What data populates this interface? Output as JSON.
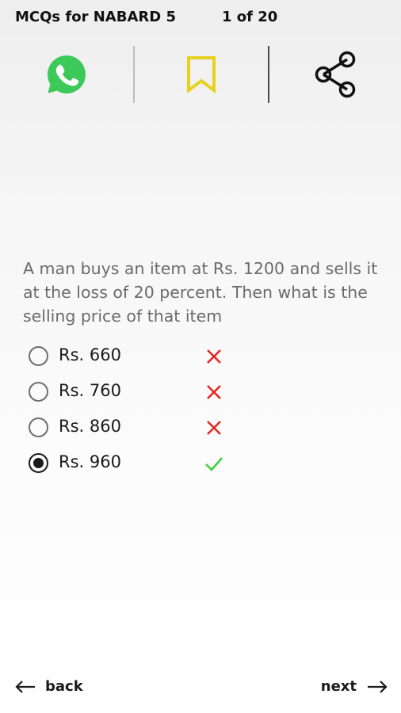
{
  "header": {
    "title": "MCQs for NABARD 5",
    "counter": "1 of 20"
  },
  "toolbar": {
    "items": [
      {
        "icon": "whatsapp-icon",
        "color": "#3dc95a"
      },
      {
        "icon": "bookmark-icon",
        "color": "#e6d21c"
      },
      {
        "icon": "share-icon",
        "color": "#111111"
      }
    ]
  },
  "question": {
    "text": "A man buys an item at Rs. 1200 and sells it at the loss of 20 percent. Then what is the selling price of that item"
  },
  "options": [
    {
      "label": "Rs. 660",
      "selected": false,
      "result": "wrong"
    },
    {
      "label": "Rs. 760",
      "selected": false,
      "result": "wrong"
    },
    {
      "label": "Rs. 860",
      "selected": false,
      "result": "wrong"
    },
    {
      "label": "Rs. 960",
      "selected": true,
      "result": "correct"
    }
  ],
  "colors": {
    "wrong": "#e8231c",
    "correct": "#3ecf3e"
  },
  "nav": {
    "back_label": "back",
    "next_label": "next"
  }
}
